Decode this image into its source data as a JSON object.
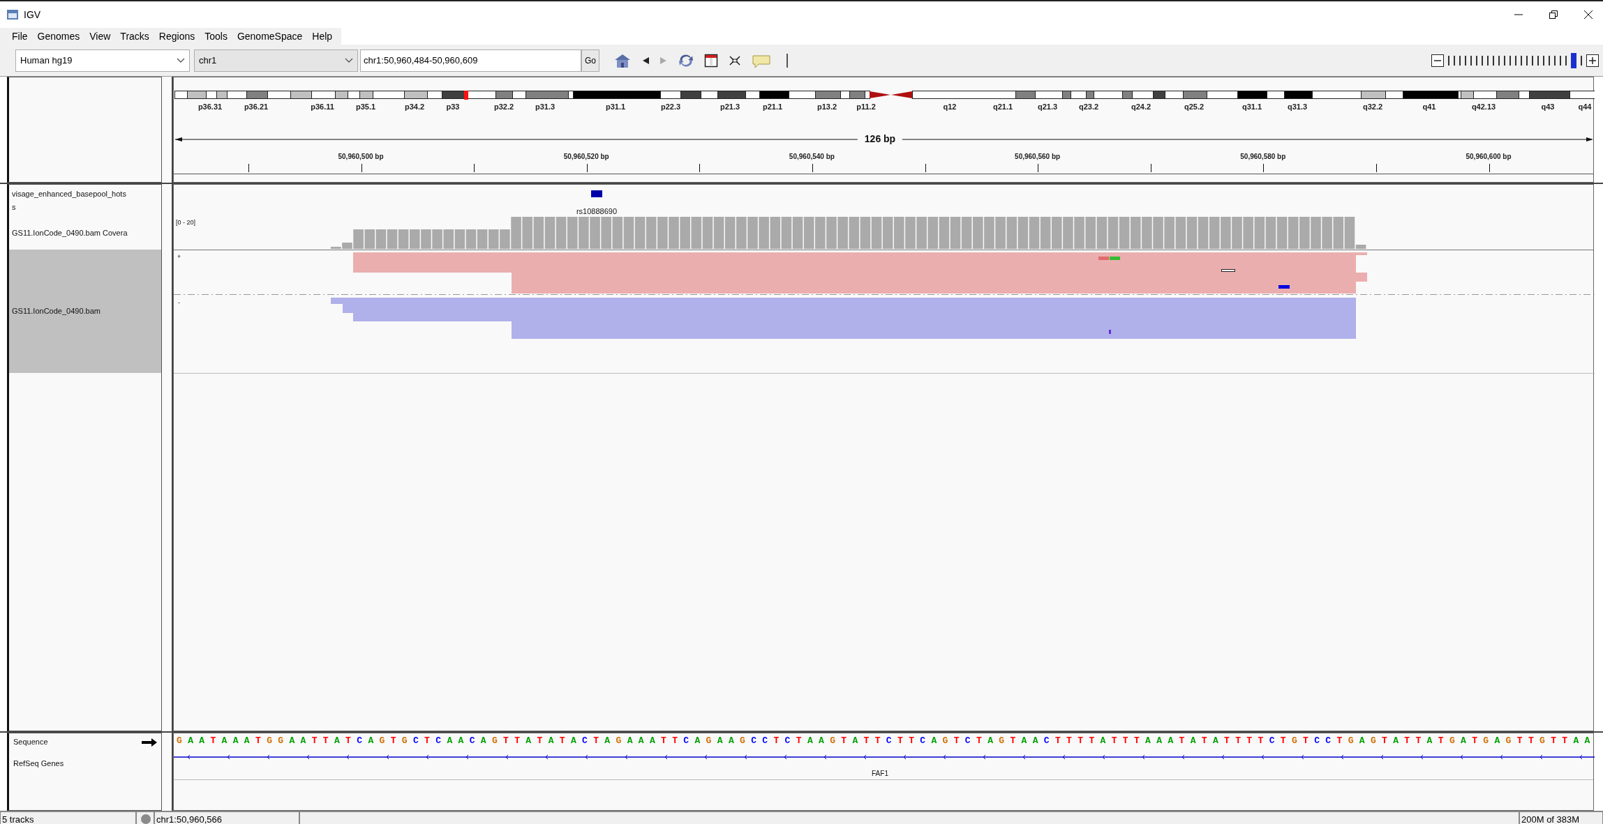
{
  "window": {
    "title": "IGV"
  },
  "menu": [
    "File",
    "Genomes",
    "View",
    "Tracks",
    "Regions",
    "Tools",
    "GenomeSpace",
    "Help"
  ],
  "toolbar": {
    "genome": "Human hg19",
    "chromosome": "chr1",
    "locus": "chr1:50,960,484-50,960,609",
    "go": "Go",
    "back": {
      "disabled": false
    },
    "forward": {
      "disabled": true
    },
    "zoom": {
      "level": 0.96
    }
  },
  "ideogram": {
    "bands": [
      "p36.31",
      "p36.21",
      "p36.11",
      "p35.1",
      "p34.2",
      "p33",
      "p32.2",
      "p31.3",
      "p31.1",
      "p22.3",
      "p21.3",
      "p21.1",
      "p13.2",
      "p11.2",
      "q12",
      "q21.1",
      "q21.3",
      "q23.2",
      "q24.2",
      "q25.2",
      "q31.1",
      "q31.3",
      "q32.2",
      "q41",
      "q42.13",
      "q43",
      "q44"
    ]
  },
  "ruler": {
    "span": "126 bp",
    "ticks": [
      "50,960,500 bp",
      "50,960,520 bp",
      "50,960,540 bp",
      "50,960,560 bp",
      "50,960,580 bp",
      "50,960,600 bp"
    ]
  },
  "tracks": [
    {
      "kind": "feature",
      "name_lines": [
        "visage_enhanced_basepool_hots",
        "s"
      ],
      "selected": false,
      "feature_label": "rs10888690"
    },
    {
      "kind": "coverage",
      "name_lines": [
        "GS11.IonCode_0490.bam Covera"
      ],
      "selected": false,
      "range": "[0 - 20]"
    },
    {
      "kind": "alignment",
      "name_lines": [
        "GS11.IonCode_0490.bam"
      ],
      "selected": true,
      "strand_labels": [
        "+",
        "-"
      ]
    }
  ],
  "lower_tracks": [
    {
      "kind": "sequence",
      "name": "Sequence",
      "bases": "GAATAAATGGAATTATCAGTGCTCAACAGTTATATACTAGAAATTCAGAAGCCTCTAAGTATTCTTCAGTCTAGTAACTTTTATTTAAATATATTTTCTGTCCTGAGTATTATGATGAGTTGTTAA"
    },
    {
      "kind": "gene",
      "name": "RefSeq Genes",
      "gene": "FAF1"
    }
  ],
  "status_bar": {
    "tracks": "5 tracks",
    "position": "chr1:50,960,566",
    "memory": "200M of 383M"
  }
}
